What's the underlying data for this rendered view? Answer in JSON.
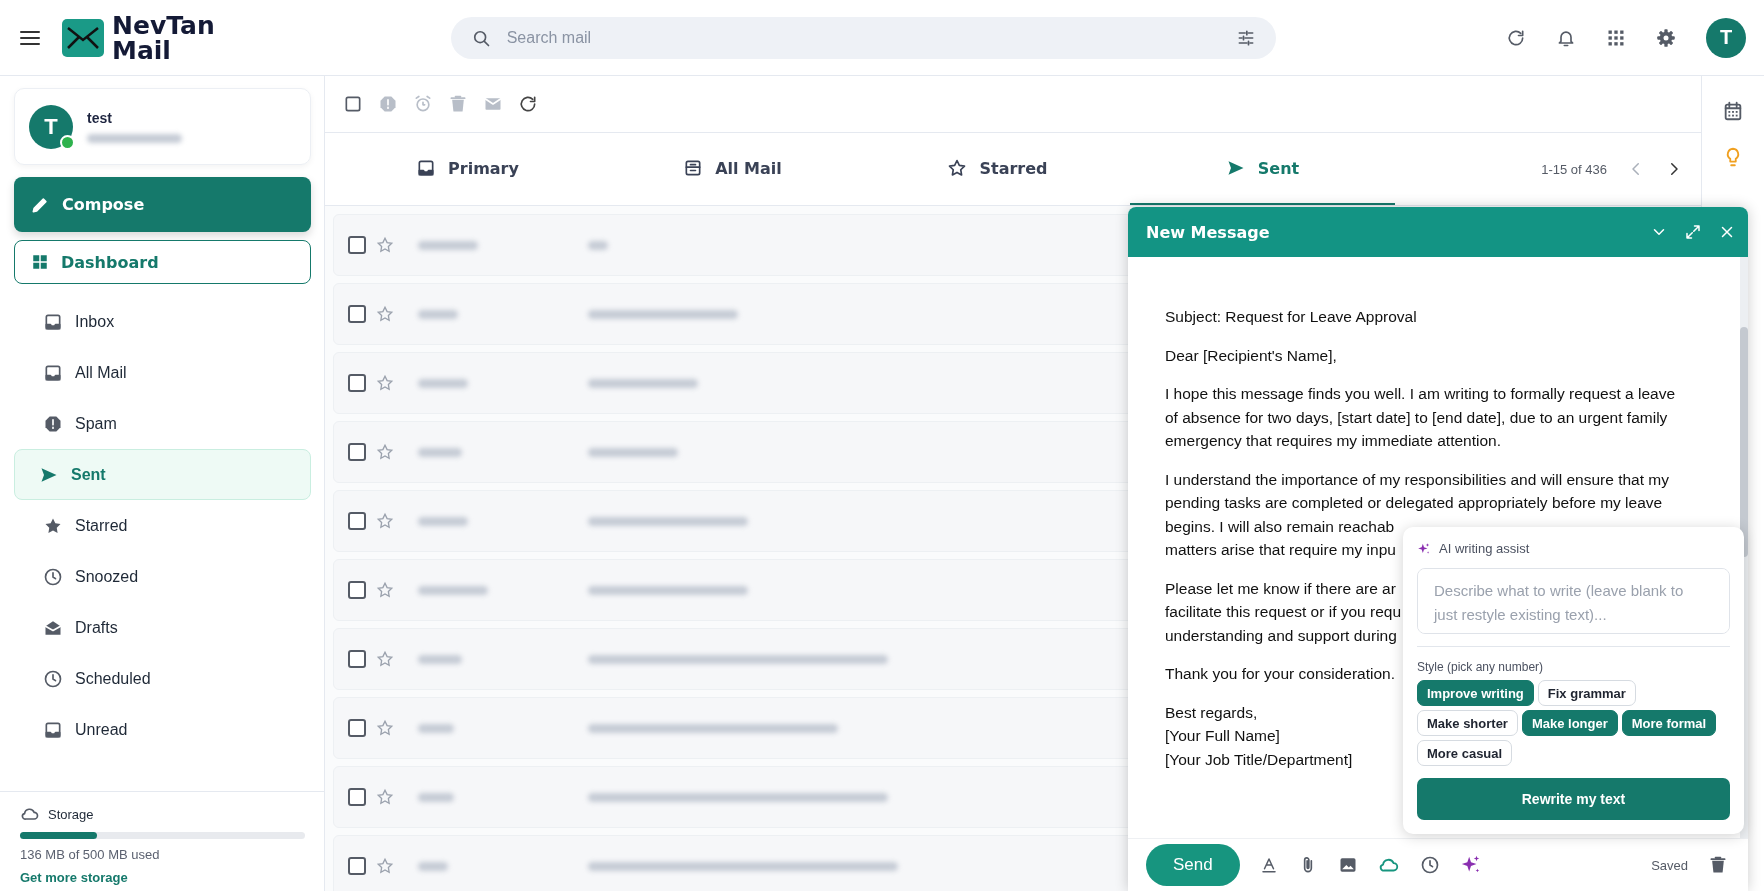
{
  "app": {
    "name_line1": "NevTan",
    "name_line2": "Mail"
  },
  "search": {
    "placeholder": "Search mail"
  },
  "header_avatar": {
    "initial": "T"
  },
  "account": {
    "name": "test",
    "initial": "T",
    "online": true
  },
  "compose_button": "Compose",
  "dashboard_button": "Dashboard",
  "sidebar": {
    "items": [
      {
        "label": "Inbox",
        "selected": false
      },
      {
        "label": "All Mail",
        "selected": false
      },
      {
        "label": "Spam",
        "selected": false
      },
      {
        "label": "Sent",
        "selected": true
      },
      {
        "label": "Starred",
        "selected": false
      },
      {
        "label": "Snoozed",
        "selected": false
      },
      {
        "label": "Drafts",
        "selected": false
      },
      {
        "label": "Scheduled",
        "selected": false
      },
      {
        "label": "Unread",
        "selected": false
      }
    ]
  },
  "storage": {
    "title": "Storage",
    "level": 0.27,
    "usage": "136 MB of 500 MB used",
    "link": "Get more storage"
  },
  "tabs": [
    {
      "label": "Primary",
      "selected": false
    },
    {
      "label": "All Mail",
      "selected": false
    },
    {
      "label": "Starred",
      "selected": false
    },
    {
      "label": "Sent",
      "selected": true
    }
  ],
  "pagination": "1-15 of 436",
  "emails": [
    {
      "checked": false,
      "starred": false
    },
    {
      "checked": false,
      "starred": false
    },
    {
      "checked": false,
      "starred": false
    },
    {
      "checked": false,
      "starred": false
    },
    {
      "checked": false,
      "starred": false
    },
    {
      "checked": false,
      "starred": false
    },
    {
      "checked": false,
      "starred": false
    },
    {
      "checked": false,
      "starred": false
    },
    {
      "checked": false,
      "starred": false
    },
    {
      "checked": false,
      "starred": false
    }
  ],
  "compose": {
    "title": "New Message",
    "paragraphs": [
      [
        "Subject: Request for Leave Approval"
      ],
      [
        "Dear [Recipient's Name],"
      ],
      [
        "I hope this message finds you well. I am writing to formally request a leave",
        "of absence for two days, [start date] to [end date], due to an urgent family",
        "emergency that requires my immediate attention."
      ],
      [
        "I understand the importance of my responsibilities and will ensure that my",
        "pending tasks are completed or delegated appropriately before my leave",
        "begins. I will also remain reachab",
        "matters arise that require my inpu"
      ],
      [
        "Please let me know if there are ar",
        "facilitate this request or if you requ",
        "understanding and support during"
      ],
      [
        "Thank you for your consideration."
      ],
      [
        "Best regards,",
        "[Your Full Name]",
        "[Your Job Title/Department]"
      ]
    ],
    "send": "Send",
    "status": "Saved"
  },
  "ai_assist": {
    "title": "AI writing assist",
    "placeholder": "Describe what to write (leave blank to just restyle existing text)...",
    "style_label": "Style (pick any number)",
    "chips": [
      {
        "label": "Improve writing",
        "selected": true
      },
      {
        "label": "Fix grammar",
        "selected": false
      },
      {
        "label": "Make shorter",
        "selected": false
      },
      {
        "label": "Make longer",
        "selected": true
      },
      {
        "label": "More formal",
        "selected": true
      },
      {
        "label": "More casual",
        "selected": false
      }
    ],
    "rewrite": "Rewrite my text"
  }
}
